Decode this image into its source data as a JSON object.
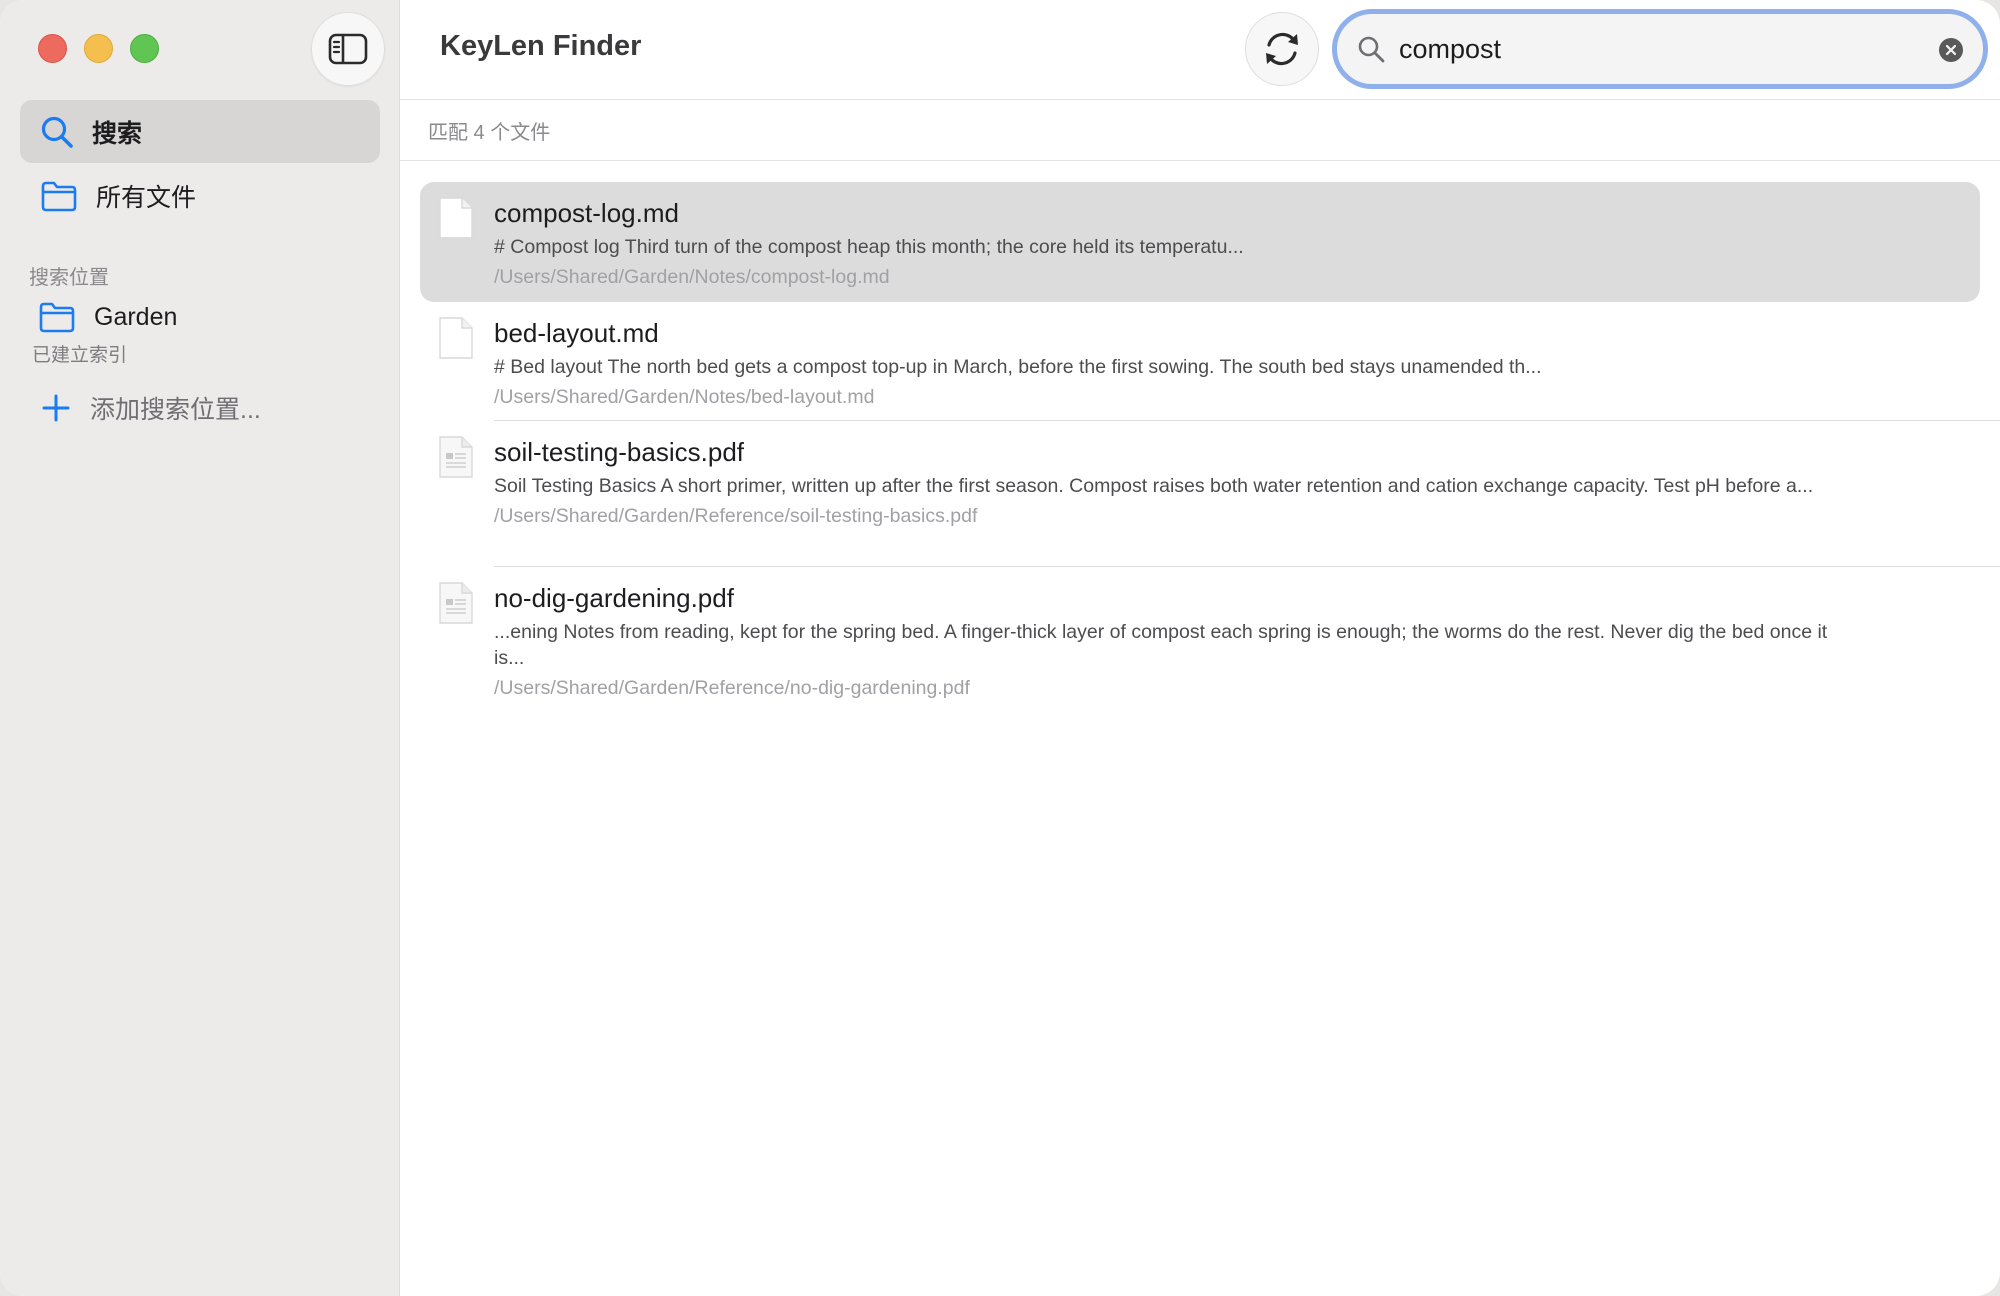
{
  "window": {
    "title": "KeyLen Finder"
  },
  "sidebar": {
    "nav": [
      {
        "label": "搜索",
        "icon": "search-icon"
      },
      {
        "label": "所有文件",
        "icon": "folder-icon"
      }
    ],
    "section_title": "搜索位置",
    "locations": [
      {
        "name": "Garden",
        "status": "已建立索引",
        "icon": "folder-icon"
      }
    ],
    "add_location_label": "添加搜索位置..."
  },
  "toolbar": {
    "search": {
      "value": "compost",
      "placeholder": ""
    }
  },
  "status": {
    "match_text": "匹配 4 个文件"
  },
  "results": [
    {
      "title": "compost-log.md",
      "snippet": "# Compost log Third turn of the compost heap this month; the core held its temperatu...",
      "path": "/Users/Shared/Garden/Notes/compost-log.md",
      "type": "md",
      "selected": true
    },
    {
      "title": "bed-layout.md",
      "snippet": "# Bed layout The north bed gets a compost top-up in March, before the first sowing. The south bed stays unamended th...",
      "path": "/Users/Shared/Garden/Notes/bed-layout.md",
      "type": "md",
      "selected": false
    },
    {
      "title": "soil-testing-basics.pdf",
      "snippet": "Soil Testing Basics A short primer, written up after the first season. Compost raises both water retention and cation exchange capacity. Test pH before a...",
      "path": "/Users/Shared/Garden/Reference/soil-testing-basics.pdf",
      "type": "pdf",
      "selected": false
    },
    {
      "title": "no-dig-gardening.pdf",
      "snippet": "...ening Notes from reading, kept for the spring bed. A finger-thick layer of compost each spring is enough; the worms do the rest. Never dig the bed once it is...",
      "path": "/Users/Shared/Garden/Reference/no-dig-gardening.pdf",
      "type": "pdf",
      "selected": false
    }
  ],
  "colors": {
    "accent": "#1a7cf0",
    "sidebar_bg": "#ecebea",
    "selected_row": "#dcdcdc",
    "search_focus_ring": "#8fb0ea"
  }
}
